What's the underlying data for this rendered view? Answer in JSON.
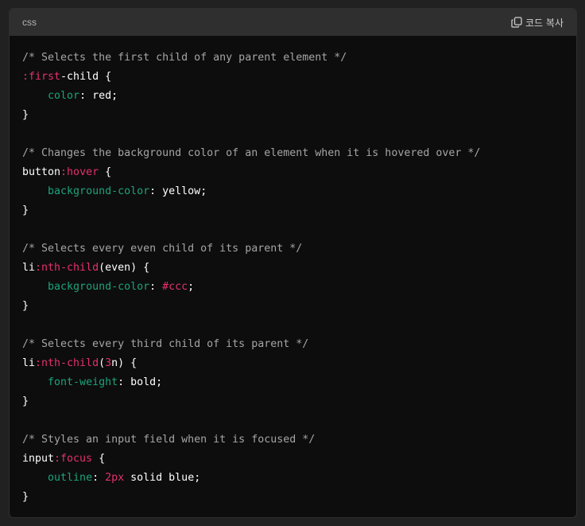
{
  "header": {
    "language": "css",
    "copy_label": "코드 복사"
  },
  "icons": {
    "copy": "copy-icon"
  },
  "colors": {
    "comment": "#a5a5a5",
    "pseudo": "#e5306f",
    "property": "#1da37a",
    "number": "#e5306f",
    "text": "#ffffff"
  },
  "code": {
    "lines": [
      [
        {
          "t": "comment",
          "v": "/* Selects the first child of any parent element */"
        }
      ],
      [
        {
          "t": "pseudo",
          "v": ":first"
        },
        {
          "t": "selector",
          "v": "-child"
        },
        {
          "t": "punct",
          "v": " {"
        }
      ],
      [
        {
          "t": "punct",
          "v": "    "
        },
        {
          "t": "prop",
          "v": "color"
        },
        {
          "t": "punct",
          "v": ": "
        },
        {
          "t": "value",
          "v": "red"
        },
        {
          "t": "punct",
          "v": ";"
        }
      ],
      [
        {
          "t": "punct",
          "v": "}"
        }
      ],
      [],
      [
        {
          "t": "comment",
          "v": "/* Changes the background color of an element when it is hovered over */"
        }
      ],
      [
        {
          "t": "selector",
          "v": "button"
        },
        {
          "t": "pseudo",
          "v": ":hover"
        },
        {
          "t": "punct",
          "v": " {"
        }
      ],
      [
        {
          "t": "punct",
          "v": "    "
        },
        {
          "t": "prop",
          "v": "background-color"
        },
        {
          "t": "punct",
          "v": ": "
        },
        {
          "t": "value",
          "v": "yellow"
        },
        {
          "t": "punct",
          "v": ";"
        }
      ],
      [
        {
          "t": "punct",
          "v": "}"
        }
      ],
      [],
      [
        {
          "t": "comment",
          "v": "/* Selects every even child of its parent */"
        }
      ],
      [
        {
          "t": "selector",
          "v": "li"
        },
        {
          "t": "pseudo",
          "v": ":nth-child"
        },
        {
          "t": "punct",
          "v": "(even) {"
        }
      ],
      [
        {
          "t": "punct",
          "v": "    "
        },
        {
          "t": "prop",
          "v": "background-color"
        },
        {
          "t": "punct",
          "v": ": "
        },
        {
          "t": "number",
          "v": "#ccc"
        },
        {
          "t": "punct",
          "v": ";"
        }
      ],
      [
        {
          "t": "punct",
          "v": "}"
        }
      ],
      [],
      [
        {
          "t": "comment",
          "v": "/* Selects every third child of its parent */"
        }
      ],
      [
        {
          "t": "selector",
          "v": "li"
        },
        {
          "t": "pseudo",
          "v": ":nth-child"
        },
        {
          "t": "punct",
          "v": "("
        },
        {
          "t": "number",
          "v": "3"
        },
        {
          "t": "punct",
          "v": "n) {"
        }
      ],
      [
        {
          "t": "punct",
          "v": "    "
        },
        {
          "t": "prop",
          "v": "font-weight"
        },
        {
          "t": "punct",
          "v": ": "
        },
        {
          "t": "value",
          "v": "bold"
        },
        {
          "t": "punct",
          "v": ";"
        }
      ],
      [
        {
          "t": "punct",
          "v": "}"
        }
      ],
      [],
      [
        {
          "t": "comment",
          "v": "/* Styles an input field when it is focused */"
        }
      ],
      [
        {
          "t": "selector",
          "v": "input"
        },
        {
          "t": "pseudo",
          "v": ":focus"
        },
        {
          "t": "punct",
          "v": " {"
        }
      ],
      [
        {
          "t": "punct",
          "v": "    "
        },
        {
          "t": "prop",
          "v": "outline"
        },
        {
          "t": "punct",
          "v": ": "
        },
        {
          "t": "number",
          "v": "2px"
        },
        {
          "t": "punct",
          "v": " "
        },
        {
          "t": "value",
          "v": "solid blue"
        },
        {
          "t": "punct",
          "v": ";"
        }
      ],
      [
        {
          "t": "punct",
          "v": "}"
        }
      ]
    ]
  }
}
